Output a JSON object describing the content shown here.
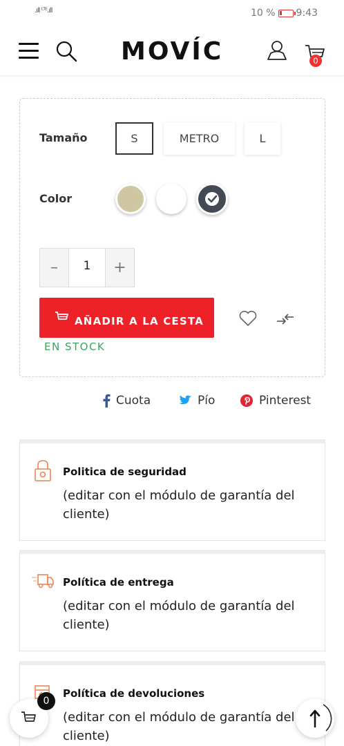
{
  "status_bar": {
    "signal": ".ıll ᴸᵀᴱ.ıll",
    "battery_text": "10 %",
    "time": "9:43"
  },
  "header": {
    "logo": "MOVÍC",
    "cart_count": "0"
  },
  "options": {
    "size_label": "Tamaño",
    "sizes": [
      "S",
      "METRO",
      "L"
    ],
    "selected_size": "S",
    "color_label": "Color",
    "colors": [
      {
        "name": "beige",
        "hex": "#cfc6a4"
      },
      {
        "name": "white",
        "hex": "#ffffff"
      },
      {
        "name": "dark",
        "hex": "#444a55"
      }
    ],
    "selected_color": "dark",
    "quantity": "1",
    "add_to_cart_label": "AÑADIR A LA CESTA",
    "stock_label": "EN STOCK"
  },
  "social": {
    "facebook": "Cuota",
    "twitter": "Pío",
    "pinterest": "Pinterest"
  },
  "policies": [
    {
      "title": "Politica de seguridad",
      "text": "(editar con el módulo de garantía del cliente)",
      "icon": "lock-icon"
    },
    {
      "title": "Política de entrega",
      "text": "(editar con el módulo de garantía del cliente)",
      "icon": "delivery-truck-icon"
    },
    {
      "title": "Política de devoluciones",
      "text": "(editar con el módulo de garantía del cliente)",
      "icon": "return-box-icon"
    }
  ],
  "floating": {
    "cart_count": "0"
  },
  "colors": {
    "accent": "#ee2128",
    "stock": "#3aa55a",
    "facebook": "#3b5998",
    "twitter": "#1da1f2",
    "pinterest": "#e02633",
    "policy_icon": "#e9834f"
  }
}
